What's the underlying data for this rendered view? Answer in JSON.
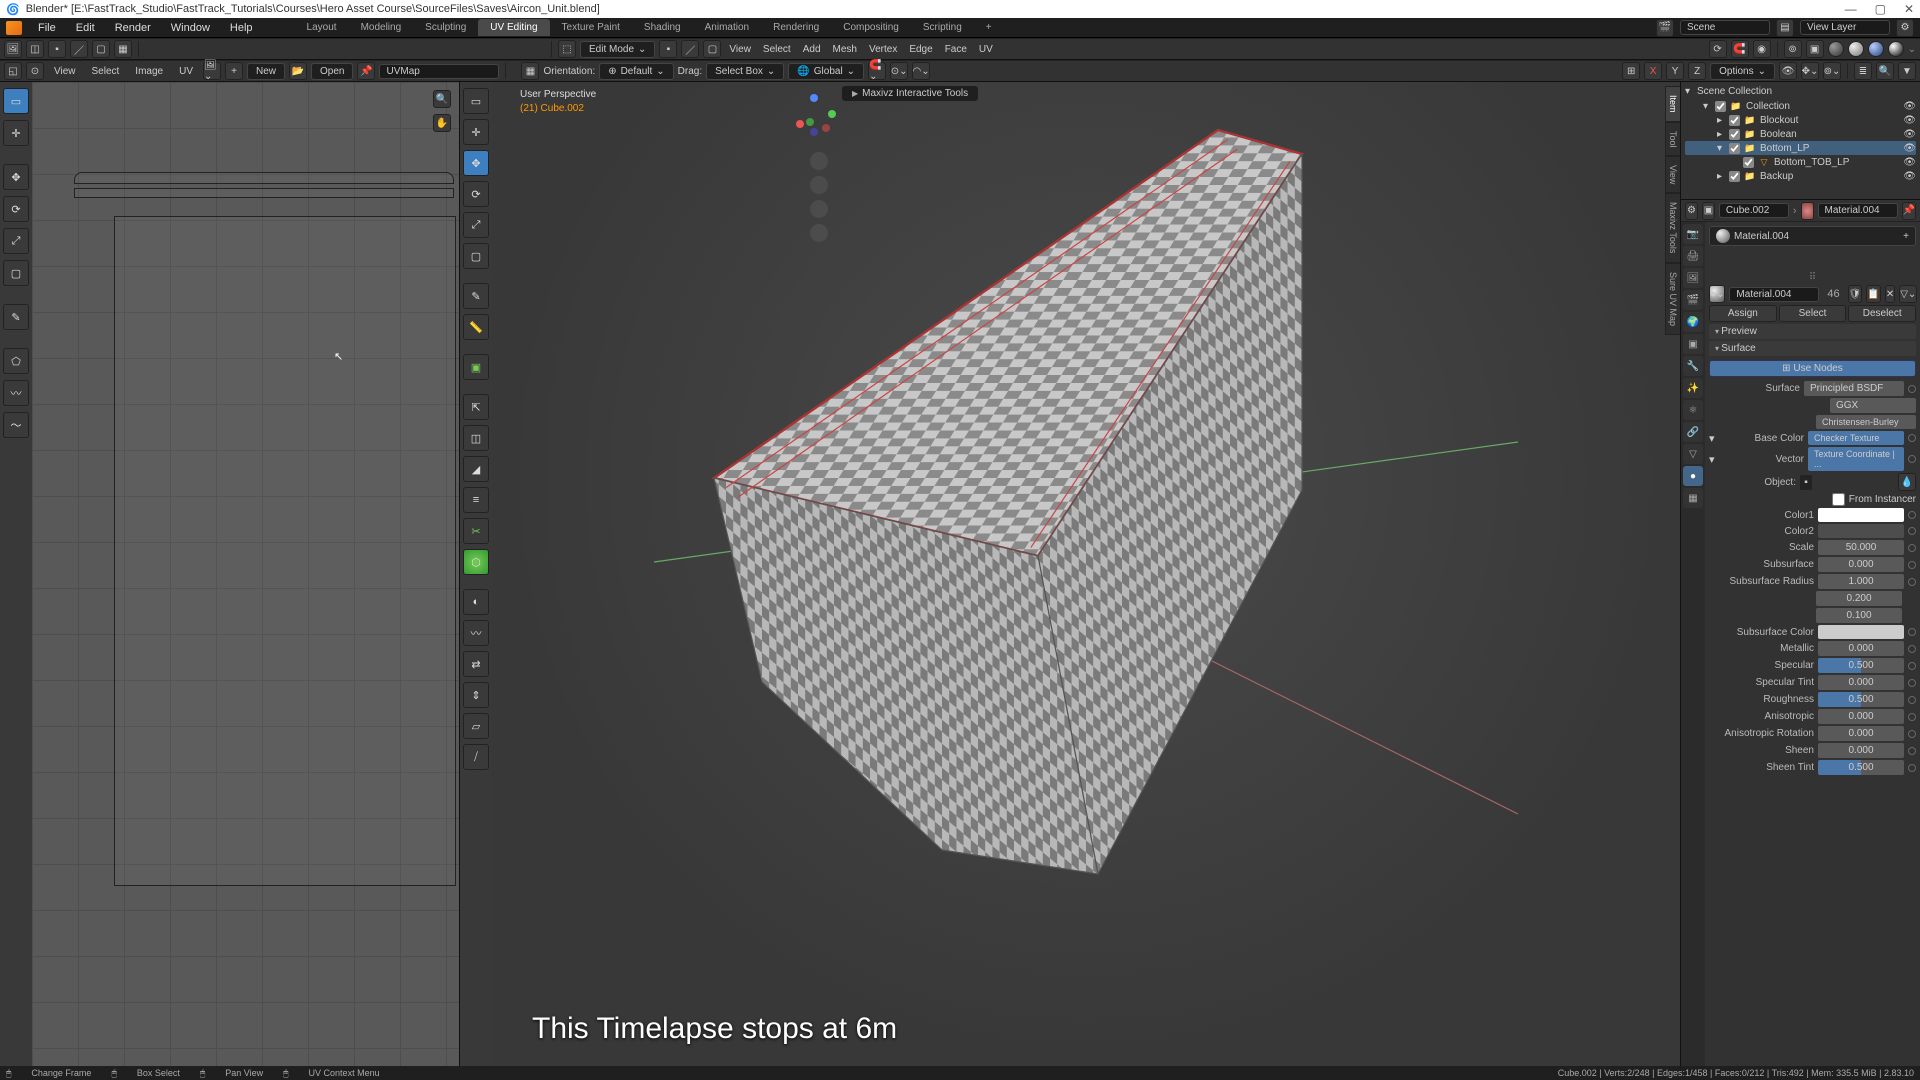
{
  "title": "Blender* [E:\\FastTrack_Studio\\FastTrack_Tutorials\\Courses\\Hero Asset Course\\SourceFiles\\Saves\\Aircon_Unit.blend]",
  "menus": [
    "File",
    "Edit",
    "Render",
    "Window",
    "Help"
  ],
  "workspaces": [
    "Layout",
    "Modeling",
    "Sculpting",
    "UV Editing",
    "Texture Paint",
    "Shading",
    "Animation",
    "Rendering",
    "Compositing",
    "Scripting"
  ],
  "workspace_active": "UV Editing",
  "scene": "Scene",
  "view_layer": "View Layer",
  "header3d": {
    "mode": "Edit Mode",
    "menus": [
      "View",
      "Select",
      "Add",
      "Mesh",
      "Vertex",
      "Edge",
      "Face",
      "UV"
    ],
    "orientation_label": "Orientation:",
    "orientation": "Default",
    "drag_label": "Drag:",
    "drag": "Select Box",
    "space": "Global",
    "options": "Options"
  },
  "uv_header": {
    "menus": [
      "View",
      "Select",
      "Image",
      "UV"
    ],
    "new": "New",
    "open": "Open",
    "map": "UVMap"
  },
  "viewport_info": {
    "l1": "User Perspective",
    "l2": "(21) Cube.002"
  },
  "viewport_tag": "Maxivz Interactive Tools",
  "right_tabs": [
    "Item",
    "Tool",
    "View",
    "Maxivz Tools",
    "Sure UV Map"
  ],
  "outliner": {
    "root": "Scene Collection",
    "items": [
      {
        "name": "Collection",
        "indent": 0,
        "tri": "▾",
        "icon": "📁"
      },
      {
        "name": "Blockout",
        "indent": 1,
        "tri": "▸",
        "icon": "📁"
      },
      {
        "name": "Boolean",
        "indent": 1,
        "tri": "▸",
        "icon": "📁"
      },
      {
        "name": "Bottom_LP",
        "indent": 1,
        "tri": "▾",
        "icon": "📁",
        "sel": true
      },
      {
        "name": "Bottom_TOB_LP",
        "indent": 2,
        "tri": "",
        "icon": "▽",
        "mesh": true
      },
      {
        "name": "Backup",
        "indent": 1,
        "tri": "▸",
        "icon": "📁"
      }
    ]
  },
  "breadcrumb": {
    "obj": "Cube.002",
    "mat": "Material.004"
  },
  "material": {
    "slot": "Material.004",
    "linked": "Material.004",
    "users": "46",
    "assign": "Assign",
    "select": "Select",
    "deselect": "Deselect",
    "preview": "Preview",
    "surface_panel": "Surface",
    "use_nodes": "Use Nodes",
    "surface_label": "Surface",
    "surface": "Principled BSDF",
    "dist": "GGX",
    "sss_method": "Christensen-Burley",
    "basecolor_label": "Base Color",
    "basecolor": "Checker Texture",
    "vector_label": "Vector",
    "vector": "Texture Coordinate | ...",
    "object_label": "Object:",
    "from_instancer": "From Instancer",
    "rows": [
      {
        "label": "Color1",
        "type": "swatch",
        "v": "#ffffff"
      },
      {
        "label": "Color2",
        "type": "swatch",
        "v": "#4d4d4d"
      },
      {
        "label": "Scale",
        "v": "50.000"
      },
      {
        "label": "Subsurface",
        "v": "0.000"
      },
      {
        "label": "Subsurface Radius",
        "v": "1.000",
        "extra": [
          "0.200",
          "0.100"
        ]
      },
      {
        "label": "Subsurface Color",
        "type": "swatch",
        "v": "#cccccc"
      },
      {
        "label": "Metallic",
        "v": "0.000"
      },
      {
        "label": "Specular",
        "v": "0.500",
        "blue": true
      },
      {
        "label": "Specular Tint",
        "v": "0.000"
      },
      {
        "label": "Roughness",
        "v": "0.500",
        "blue": true
      },
      {
        "label": "Anisotropic",
        "v": "0.000"
      },
      {
        "label": "Anisotropic Rotation",
        "v": "0.000"
      },
      {
        "label": "Sheen",
        "v": "0.000"
      },
      {
        "label": "Sheen Tint",
        "v": "0.500",
        "blue": true
      }
    ]
  },
  "status": {
    "left": [
      "Change Frame",
      "Box Select",
      "Pan View",
      "UV Context Menu"
    ],
    "right": "Cube.002  |  Verts:2/248  |  Edges:1/458  |  Faces:0/212  |  Tris:492  |  Mem: 335.5 MiB  |  2.83.10"
  },
  "caption": "This Timelapse stops at 6m"
}
